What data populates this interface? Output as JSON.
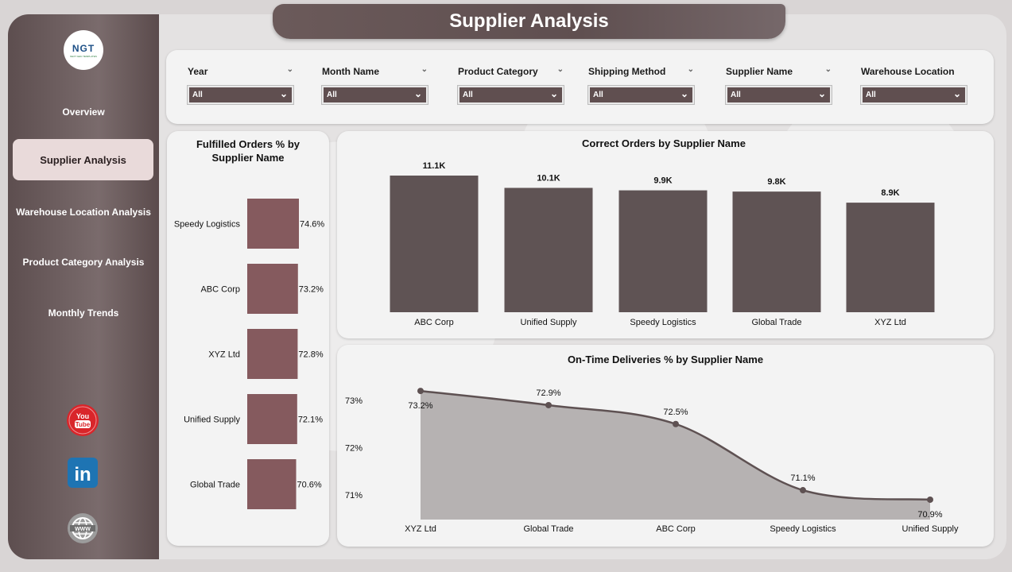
{
  "header": {
    "title": "Supplier Analysis"
  },
  "logo": {
    "text": "NGT",
    "subtext": "NEXT GEN TEMPLATES"
  },
  "nav": [
    {
      "label": "Overview",
      "active": false
    },
    {
      "label": "Supplier Analysis",
      "active": true
    },
    {
      "label": "Warehouse Location Analysis",
      "active": false
    },
    {
      "label": "Product Category Analysis",
      "active": false
    },
    {
      "label": "Monthly Trends",
      "active": false
    }
  ],
  "social": [
    {
      "icon": "youtube-icon",
      "text": "You Tube"
    },
    {
      "icon": "linkedin-icon",
      "text": "in"
    },
    {
      "icon": "globe-icon",
      "text": "WWW"
    }
  ],
  "filters": [
    {
      "label": "Year",
      "value": "All"
    },
    {
      "label": "Month Name",
      "value": "All"
    },
    {
      "label": "Product Category",
      "value": "All"
    },
    {
      "label": "Shipping Method",
      "value": "All"
    },
    {
      "label": "Supplier Name",
      "value": "All"
    },
    {
      "label": "Warehouse Location",
      "value": "All"
    }
  ],
  "colors": {
    "bar_fulfilled": "#855a5e",
    "bar_correct": "#5f5354",
    "line": "#5e5152",
    "area": "#b6b2b2"
  },
  "chart_data": [
    {
      "type": "bar",
      "orientation": "horizontal",
      "title": "Fulfilled Orders % by Supplier Name",
      "categories": [
        "Speedy Logistics",
        "ABC Corp",
        "XYZ Ltd",
        "Unified Supply",
        "Global Trade"
      ],
      "values": [
        74.6,
        73.2,
        72.8,
        72.1,
        70.6
      ],
      "labels": [
        "74.6%",
        "73.2%",
        "72.8%",
        "72.1%",
        "70.6%"
      ]
    },
    {
      "type": "bar",
      "title": "Correct Orders by Supplier Name",
      "categories": [
        "ABC Corp",
        "Unified Supply",
        "Speedy Logistics",
        "Global Trade",
        "XYZ Ltd"
      ],
      "values": [
        11100,
        10100,
        9900,
        9800,
        8900
      ],
      "labels": [
        "11.1K",
        "10.1K",
        "9.9K",
        "9.8K",
        "8.9K"
      ]
    },
    {
      "type": "area",
      "title": "On-Time Deliveries % by Supplier Name",
      "categories": [
        "XYZ Ltd",
        "Global Trade",
        "ABC Corp",
        "Speedy Logistics",
        "Unified Supply"
      ],
      "values": [
        73.2,
        72.9,
        72.5,
        71.1,
        70.9
      ],
      "labels": [
        "73.2%",
        "72.9%",
        "72.5%",
        "71.1%",
        "70.9%"
      ],
      "yticks": [
        "73%",
        "72%",
        "71%"
      ]
    }
  ]
}
